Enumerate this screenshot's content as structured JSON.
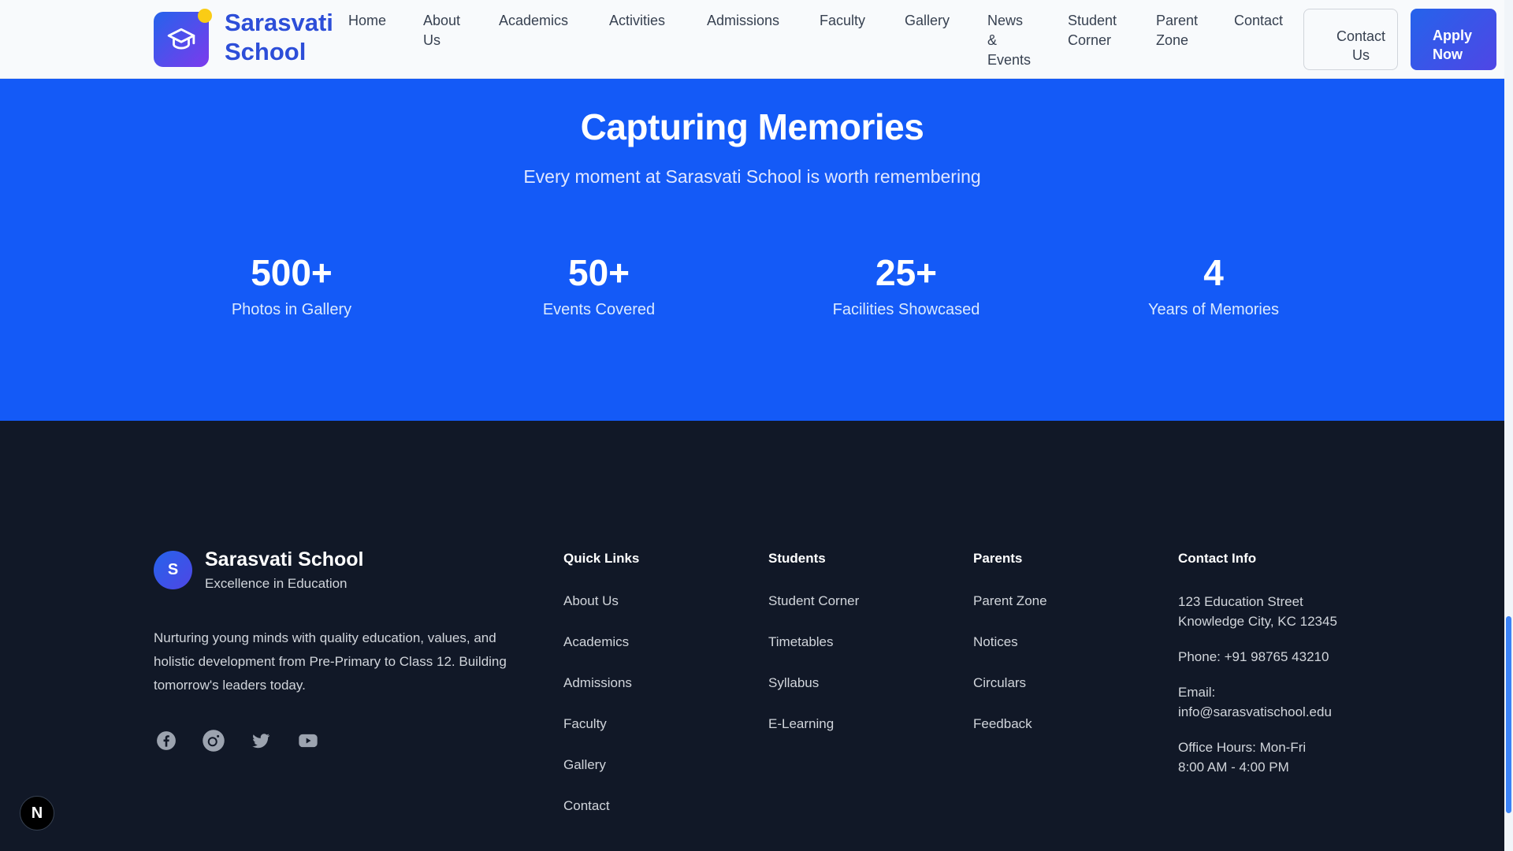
{
  "header": {
    "brand_line1": "Sarasvati",
    "brand_line2": "School",
    "nav": [
      {
        "l1": "Home",
        "l2": "",
        "l3": ""
      },
      {
        "l1": "About",
        "l2": "Us",
        "l3": ""
      },
      {
        "l1": "Academics",
        "l2": "",
        "l3": ""
      },
      {
        "l1": "Activities",
        "l2": "",
        "l3": ""
      },
      {
        "l1": "Admissions",
        "l2": "",
        "l3": ""
      },
      {
        "l1": "Faculty",
        "l2": "",
        "l3": ""
      },
      {
        "l1": "Gallery",
        "l2": "",
        "l3": ""
      },
      {
        "l1": "News",
        "l2": "&",
        "l3": "Events"
      },
      {
        "l1": "Student",
        "l2": "Corner",
        "l3": ""
      },
      {
        "l1": "Parent",
        "l2": "Zone",
        "l3": ""
      },
      {
        "l1": "Contact",
        "l2": "",
        "l3": ""
      }
    ],
    "contact_btn_l1": "Contact",
    "contact_btn_l2": "Us",
    "apply_btn_l1": "Apply",
    "apply_btn_l2": "Now"
  },
  "hero": {
    "title": "Capturing Memories",
    "subtitle": "Every moment at Sarasvati School is worth remembering",
    "stats": [
      {
        "value": "500+",
        "label": "Photos in Gallery"
      },
      {
        "value": "50+",
        "label": "Events Covered"
      },
      {
        "value": "25+",
        "label": "Facilities Showcased"
      },
      {
        "value": "4",
        "label": "Years of Memories"
      }
    ]
  },
  "footer": {
    "avatar_letter": "S",
    "name": "Sarasvati School",
    "tagline": "Excellence in Education",
    "description": "Nurturing young minds with quality education, values, and holistic development from Pre-Primary to Class 12. Building tomorrow's leaders today.",
    "socials": [
      "facebook-icon",
      "instagram-icon",
      "twitter-icon",
      "youtube-icon"
    ],
    "quick_links": {
      "title": "Quick Links",
      "items": [
        "About Us",
        "Academics",
        "Admissions",
        "Faculty",
        "Gallery",
        "Contact"
      ]
    },
    "students": {
      "title": "Students",
      "items": [
        "Student Corner",
        "Timetables",
        "Syllabus",
        "E-Learning"
      ]
    },
    "parents": {
      "title": "Parents",
      "items": [
        "Parent Zone",
        "Notices",
        "Circulars",
        "Feedback"
      ]
    },
    "contact": {
      "title": "Contact Info",
      "address_l1": "123 Education Street",
      "address_l2": "Knowledge City, KC 12345",
      "phone": "Phone: +91 98765 43210",
      "email_label": "Email:",
      "email": "info@sarasvatischool.edu",
      "hours_l1": "Office Hours: Mon-Fri",
      "hours_l2": "8:00 AM - 4:00 PM"
    }
  },
  "badge_letter": "N",
  "colors": {
    "hero_bg": "#145af7",
    "footer_bg": "#111827",
    "brand": "#2d4ed8",
    "accent": "#facc15"
  }
}
